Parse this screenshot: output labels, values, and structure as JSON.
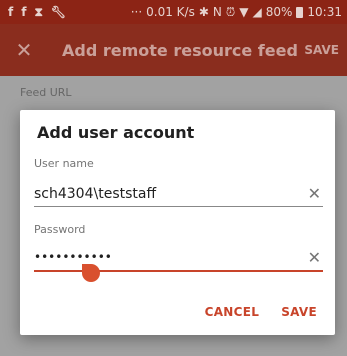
{
  "status_bar": {
    "network_speed": "0.01 K/s",
    "battery": "80%",
    "time": "10:31"
  },
  "toolbar": {
    "title": "Add remote resource feed",
    "save_label": "SAVE"
  },
  "background": {
    "feed_url_label": "Feed URL"
  },
  "dialog": {
    "title": "Add user account",
    "username": {
      "label": "User name",
      "value": "sch4304\\teststaff"
    },
    "password": {
      "label": "Password",
      "value": "•••••••••••"
    },
    "cancel_label": "CANCEL",
    "save_label": "SAVE"
  },
  "colors": {
    "status_bar": "#8c2415",
    "toolbar": "#8a2d1e",
    "accent": "#c8442a"
  }
}
